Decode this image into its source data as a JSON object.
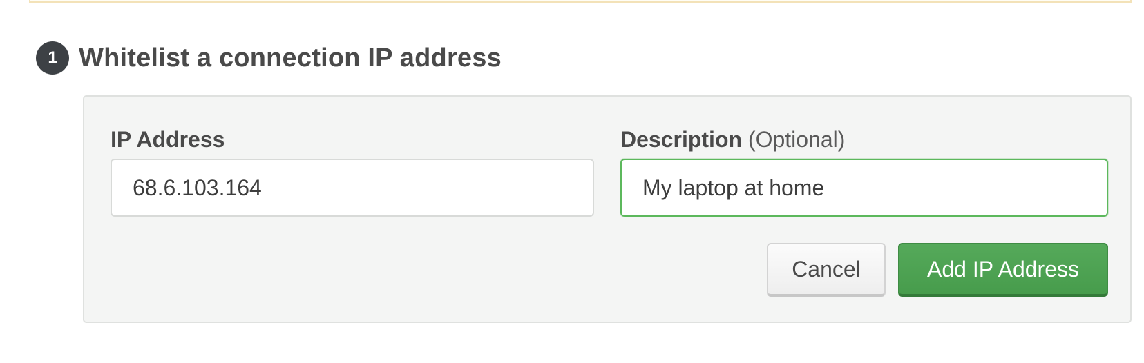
{
  "step": {
    "number": "1",
    "title": "Whitelist a connection IP address"
  },
  "form": {
    "ip_label": "IP Address",
    "ip_value": "68.6.103.164",
    "description_label": "Description",
    "description_optional": "(Optional)",
    "description_value": "My laptop at home"
  },
  "actions": {
    "cancel_label": "Cancel",
    "add_label": "Add IP Address"
  },
  "colors": {
    "badge": "#3d4145",
    "primary_button": "#4ea353",
    "focus_border": "#5cb85c",
    "panel_background": "#f4f5f4"
  }
}
